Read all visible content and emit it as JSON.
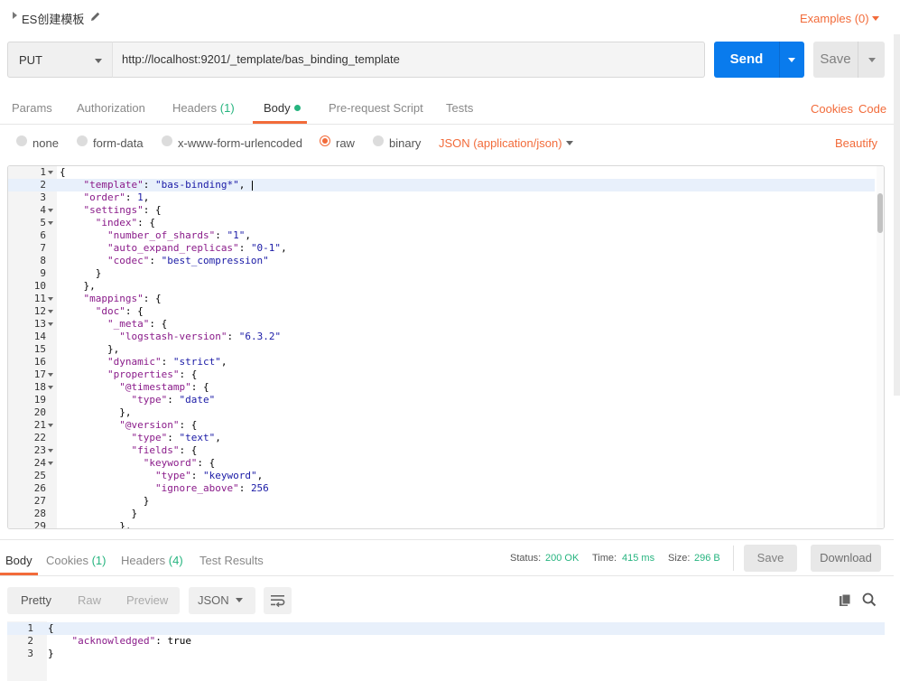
{
  "title_row": {
    "name": "ES创建模板",
    "examples": "Examples (0)"
  },
  "request": {
    "method": "PUT",
    "url": "http://localhost:9201/_template/bas_binding_template",
    "send_label": "Send",
    "save_label": "Save"
  },
  "request_tabs": [
    {
      "label": "Params"
    },
    {
      "label": "Authorization"
    },
    {
      "label": "Headers",
      "count": "(1)"
    },
    {
      "label": "Body"
    },
    {
      "label": "Pre-request Script"
    },
    {
      "label": "Tests"
    }
  ],
  "request_links": {
    "cookies": "Cookies",
    "code": "Code"
  },
  "body_types": [
    {
      "label": "none",
      "selected": false
    },
    {
      "label": "form-data",
      "selected": false
    },
    {
      "label": "x-www-form-urlencoded",
      "selected": false
    },
    {
      "label": "raw",
      "selected": true
    },
    {
      "label": "binary",
      "selected": false
    }
  ],
  "content_type": "JSON (application/json)",
  "beautify": "Beautify",
  "editor": {
    "line_numbers": [
      "1",
      "2",
      "3",
      "4",
      "5",
      "6",
      "7",
      "8",
      "9",
      "10",
      "11",
      "12",
      "13",
      "14",
      "15",
      "16",
      "17",
      "18",
      "19",
      "20",
      "21",
      "22",
      "23",
      "24",
      "25",
      "26",
      "27",
      "28",
      "29"
    ],
    "fold_lines": [
      1,
      4,
      5,
      11,
      12,
      13,
      17,
      18,
      21,
      23,
      24
    ],
    "lines": [
      [
        [
          "p",
          "{"
        ]
      ],
      [
        [
          "p",
          "    "
        ],
        [
          "k",
          "\"template\""
        ],
        [
          "p",
          ": "
        ],
        [
          "s",
          "\"bas-binding*\""
        ],
        [
          "p",
          ","
        ]
      ],
      [
        [
          "p",
          "    "
        ],
        [
          "k",
          "\"order\""
        ],
        [
          "p",
          ": "
        ],
        [
          "n",
          "1"
        ],
        [
          "p",
          ","
        ]
      ],
      [
        [
          "p",
          "    "
        ],
        [
          "k",
          "\"settings\""
        ],
        [
          "p",
          ": {"
        ]
      ],
      [
        [
          "p",
          "      "
        ],
        [
          "k",
          "\"index\""
        ],
        [
          "p",
          ": {"
        ]
      ],
      [
        [
          "p",
          "        "
        ],
        [
          "k",
          "\"number_of_shards\""
        ],
        [
          "p",
          ": "
        ],
        [
          "s",
          "\"1\""
        ],
        [
          "p",
          ","
        ]
      ],
      [
        [
          "p",
          "        "
        ],
        [
          "k",
          "\"auto_expand_replicas\""
        ],
        [
          "p",
          ": "
        ],
        [
          "s",
          "\"0-1\""
        ],
        [
          "p",
          ","
        ]
      ],
      [
        [
          "p",
          "        "
        ],
        [
          "k",
          "\"codec\""
        ],
        [
          "p",
          ": "
        ],
        [
          "s",
          "\"best_compression\""
        ]
      ],
      [
        [
          "p",
          "      }"
        ]
      ],
      [
        [
          "p",
          "    },"
        ]
      ],
      [
        [
          "p",
          "    "
        ],
        [
          "k",
          "\"mappings\""
        ],
        [
          "p",
          ": {"
        ]
      ],
      [
        [
          "p",
          "      "
        ],
        [
          "k",
          "\"doc\""
        ],
        [
          "p",
          ": {"
        ]
      ],
      [
        [
          "p",
          "        "
        ],
        [
          "k",
          "\"_meta\""
        ],
        [
          "p",
          ": {"
        ]
      ],
      [
        [
          "p",
          "          "
        ],
        [
          "k",
          "\"logstash-version\""
        ],
        [
          "p",
          ": "
        ],
        [
          "s",
          "\"6.3.2\""
        ]
      ],
      [
        [
          "p",
          "        },"
        ]
      ],
      [
        [
          "p",
          "        "
        ],
        [
          "k",
          "\"dynamic\""
        ],
        [
          "p",
          ": "
        ],
        [
          "s",
          "\"strict\""
        ],
        [
          "p",
          ","
        ]
      ],
      [
        [
          "p",
          "        "
        ],
        [
          "k",
          "\"properties\""
        ],
        [
          "p",
          ": {"
        ]
      ],
      [
        [
          "p",
          "          "
        ],
        [
          "k",
          "\"@timestamp\""
        ],
        [
          "p",
          ": {"
        ]
      ],
      [
        [
          "p",
          "            "
        ],
        [
          "k",
          "\"type\""
        ],
        [
          "p",
          ": "
        ],
        [
          "s",
          "\"date\""
        ]
      ],
      [
        [
          "p",
          "          },"
        ]
      ],
      [
        [
          "p",
          "          "
        ],
        [
          "k",
          "\"@version\""
        ],
        [
          "p",
          ": {"
        ]
      ],
      [
        [
          "p",
          "            "
        ],
        [
          "k",
          "\"type\""
        ],
        [
          "p",
          ": "
        ],
        [
          "s",
          "\"text\""
        ],
        [
          "p",
          ","
        ]
      ],
      [
        [
          "p",
          "            "
        ],
        [
          "k",
          "\"fields\""
        ],
        [
          "p",
          ": {"
        ]
      ],
      [
        [
          "p",
          "              "
        ],
        [
          "k",
          "\"keyword\""
        ],
        [
          "p",
          ": {"
        ]
      ],
      [
        [
          "p",
          "                "
        ],
        [
          "k",
          "\"type\""
        ],
        [
          "p",
          ": "
        ],
        [
          "s",
          "\"keyword\""
        ],
        [
          "p",
          ","
        ]
      ],
      [
        [
          "p",
          "                "
        ],
        [
          "k",
          "\"ignore_above\""
        ],
        [
          "p",
          ": "
        ],
        [
          "n",
          "256"
        ]
      ],
      [
        [
          "p",
          "              }"
        ]
      ],
      [
        [
          "p",
          "            }"
        ]
      ],
      [
        [
          "p",
          "          },"
        ]
      ]
    ]
  },
  "response_tabs": [
    {
      "label": "Body"
    },
    {
      "label": "Cookies",
      "count": "(1)"
    },
    {
      "label": "Headers",
      "count": "(4)"
    },
    {
      "label": "Test Results"
    }
  ],
  "response_status": {
    "status_label": "Status:",
    "status_value": "200 OK",
    "time_label": "Time:",
    "time_value": "415 ms",
    "size_label": "Size:",
    "size_value": "296 B"
  },
  "response_actions": {
    "save": "Save",
    "download": "Download"
  },
  "response_views": [
    "Pretty",
    "Raw",
    "Preview"
  ],
  "response_format": "JSON",
  "response_body": {
    "line_numbers": [
      "1",
      "2",
      "3"
    ],
    "lines": [
      [
        [
          "p",
          "{"
        ]
      ],
      [
        [
          "p",
          "    "
        ],
        [
          "k",
          "\"acknowledged\""
        ],
        [
          "p",
          ": "
        ],
        [
          "p",
          "true"
        ]
      ],
      [
        [
          "p",
          "}"
        ]
      ]
    ]
  },
  "colors": {
    "accent": "#f26b3a",
    "send": "#097bed",
    "success": "#26b47f"
  },
  "icons": [
    "edit-icon",
    "copy-icon",
    "search-icon",
    "wrap-lines-icon"
  ]
}
